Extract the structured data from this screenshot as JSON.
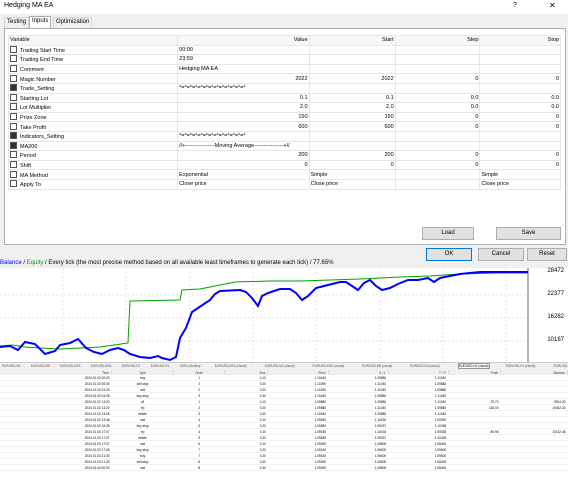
{
  "window": {
    "title": "Hedging MA EA",
    "help_glyph": "?",
    "close_glyph": "✕"
  },
  "tabs": [
    {
      "label": "Testing"
    },
    {
      "label": "Inputs"
    },
    {
      "label": "Optimization"
    }
  ],
  "columns": {
    "variable": "Variable",
    "value": "Value",
    "start": "Start",
    "step": "Step",
    "stop": "Stop"
  },
  "rows": [
    {
      "name": "Trading Start Time",
      "value": "00:00",
      "start": "",
      "step": "",
      "stop": ""
    },
    {
      "name": "Trading End Time",
      "value": "23:59",
      "start": "",
      "step": "",
      "stop": ""
    },
    {
      "name": "Comment",
      "value": "Hedging MA EA",
      "start": "",
      "step": "",
      "stop": ""
    },
    {
      "name": "Magic Number",
      "value": "2022",
      "start": "2022",
      "step": "0",
      "stop": "0"
    },
    {
      "name": "Trade_Setting",
      "value": "*=*=*=*=*=*=*=*=*=*=*=*=*",
      "start": "",
      "step": "",
      "stop": ""
    },
    {
      "name": "Starting Lot",
      "value": "0.1",
      "start": "0.1",
      "step": "0.0",
      "stop": "0.0"
    },
    {
      "name": "Lot Multiplier",
      "value": "2.0",
      "start": "2.0",
      "step": "0.0",
      "stop": "0.0"
    },
    {
      "name": "Prize Zone",
      "value": "150",
      "start": "150",
      "step": "0",
      "stop": "0"
    },
    {
      "name": "Take Profit",
      "value": "600",
      "start": "600",
      "step": "0",
      "stop": "0"
    },
    {
      "name": "Indicators_Setting",
      "value": "*=*=*=*=*=*=*=*=*=*=*=*=*",
      "start": "",
      "step": "",
      "stop": ""
    },
    {
      "name": "MA200",
      "value": "//+----------------Moving Average----------------+//",
      "start": "",
      "step": "",
      "stop": ""
    },
    {
      "name": "Period",
      "value": "200",
      "start": "200",
      "step": "0",
      "stop": "0"
    },
    {
      "name": "Shift",
      "value": "0",
      "start": "0",
      "step": "0",
      "stop": "0"
    },
    {
      "name": "MA Method",
      "value": "Exponential",
      "start": "Simple",
      "step": "",
      "stop": "Simple"
    },
    {
      "name": "Apply To",
      "value": "Close price",
      "start": "Close price",
      "step": "",
      "stop": "Close price"
    }
  ],
  "buttons": {
    "load": "Load",
    "save": "Save",
    "ok": "OK",
    "cancel": "Cancel",
    "reset": "Reset"
  },
  "chart": {
    "balance_label": "Balance",
    "sep": " / ",
    "equity_label": "Equity",
    "description": " / Every tick (the most precise method based on all available least timeframes to generate each tick) / 77.65%",
    "y_ticks": [
      "28472",
      "22377",
      "16282",
      "10187"
    ],
    "balance_color": "#0000ff",
    "equity_color": "#00a000"
  },
  "chart_tabs": [
    "EURUSD,M1",
    "EURUSD,M5",
    "EURUSD,M15",
    "EURUSD,M30",
    "EURUSD,H1",
    "EURUSD,H4",
    "USDX,Monthly",
    "EURUSD,M15 (visual)",
    "EURUSD,M1 (visual)",
    "EURUSD,M15 (visual)",
    "EURUSD,M5 (visual)",
    "EURUSD,H4 (visual)",
    "EURUSD,H1 (visual)",
    "EURUSD,H1 (visual)",
    "EURUSD,H1 (visual)"
  ],
  "deals_columns": [
    "Time",
    "Type",
    "Order",
    "Size",
    "Price",
    "S / L",
    "T / P",
    "Profit",
    "Balance"
  ],
  "deals": [
    [
      "2024.01.02 00:00",
      "buy",
      "1",
      "0.10",
      "1.10440",
      "1.09880",
      "1.11040",
      "",
      ""
    ],
    [
      "2024.01.02 00:00",
      "sell stop",
      "2",
      "0.20",
      "1.10290",
      "1.11040",
      "1.09880",
      "",
      ""
    ],
    [
      "2024.01.02 04:20",
      "sell",
      "2",
      "0.20",
      "1.10290",
      "1.11040",
      "1.09880",
      "",
      ""
    ],
    [
      "2024.01.02 04:26",
      "buy stop",
      "3",
      "0.40",
      "1.10440",
      "1.09880",
      "1.11040",
      "",
      ""
    ],
    [
      "2024.01.02 13:20",
      "s/l",
      "1",
      "0.10",
      "1.09880",
      "1.09880",
      "1.11040",
      "-75.70",
      "9924.30"
    ],
    [
      "2024.01.02 13:20",
      "t/p",
      "2",
      "0.20",
      "1.09880",
      "1.11040",
      "1.09880",
      "118.00",
      "10042.30"
    ],
    [
      "2024.01.02 13:46",
      "delete",
      "3",
      "0.40",
      "1.10440",
      "1.09880",
      "1.11040",
      "",
      ""
    ],
    [
      "2024.01.02 13:46",
      "sell",
      "4",
      "0.10",
      "1.09630",
      "1.10430",
      "1.09030",
      "",
      ""
    ],
    [
      "2024.01.02 15:35",
      "buy stop",
      "5",
      "0.20",
      "1.09830",
      "1.09037",
      "1.10435",
      "",
      ""
    ],
    [
      "2024.01.03 17:07",
      "t/p",
      "4",
      "0.10",
      "1.09035",
      "1.10435",
      "1.09035",
      "89.96",
      "10132.46"
    ],
    [
      "2024.01.03 17:07",
      "delete",
      "5",
      "0.20",
      "1.09835",
      "1.09037",
      "1.10435",
      "",
      ""
    ],
    [
      "2024.01.03 17:07",
      "sell",
      "6",
      "0.10",
      "1.09000",
      "1.09600",
      "1.08400",
      "",
      ""
    ],
    [
      "2024.01.03 17:08",
      "buy stop",
      "7",
      "0.20",
      "1.09150",
      "1.08400",
      "1.09600",
      "",
      ""
    ],
    [
      "2024.01.03 21:30",
      "buy",
      "7",
      "0.20",
      "1.09150",
      "1.08400",
      "1.09600",
      "",
      ""
    ],
    [
      "2024.01.03 21:30",
      "sell stop",
      "8",
      "0.40",
      "1.09000",
      "1.09600",
      "1.08400",
      "",
      ""
    ],
    [
      "2024.01.04 00:00",
      "sell",
      "8",
      "0.40",
      "1.09000",
      "1.09600",
      "1.08400",
      "",
      ""
    ]
  ]
}
